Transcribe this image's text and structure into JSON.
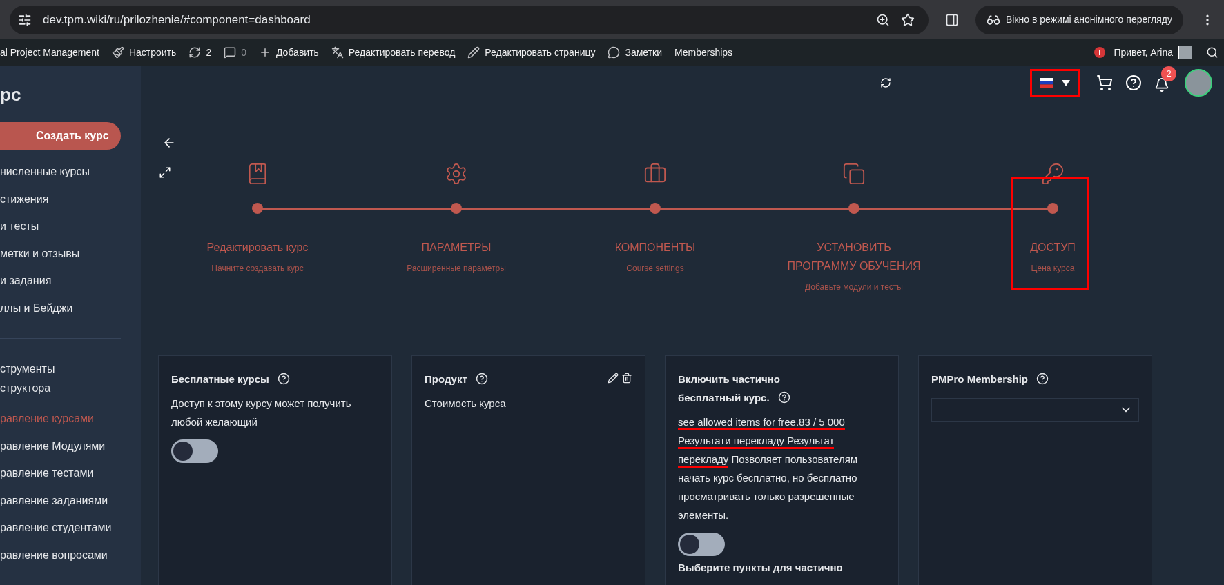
{
  "browser": {
    "url": "dev.tpm.wiki/ru/prilozhenie/#component=dashboard",
    "incognito_label": "Вікно в режимі анонімного перегляду"
  },
  "admin_bar": {
    "items": [
      {
        "kind": "brand",
        "label": "al Project Management"
      },
      {
        "kind": "customize",
        "label": "Настроить"
      },
      {
        "kind": "updates",
        "label": "2"
      },
      {
        "kind": "comments",
        "label": "0"
      },
      {
        "kind": "new",
        "label": "Добавить"
      },
      {
        "kind": "translate",
        "label": "Редактировать перевод"
      },
      {
        "kind": "edit",
        "label": "Редактировать страницу"
      },
      {
        "kind": "notes",
        "label": "Заметки"
      },
      {
        "kind": "plain",
        "label": "Memberships"
      }
    ],
    "greeting": "Привет, Arina"
  },
  "sidebar": {
    "title": "рс",
    "create_button": "Создать курс",
    "sections": [
      {
        "items": [
          {
            "label": "нисленные курсы",
            "selected": false
          },
          {
            "label": "стижения",
            "selected": false
          },
          {
            "label": "и тесты",
            "selected": false
          },
          {
            "label": "метки и отзывы",
            "selected": false
          },
          {
            "label": "и задания",
            "selected": false
          },
          {
            "label": "ллы и Бейджи",
            "selected": false
          }
        ]
      },
      {
        "heading": "струменты\nструктора",
        "items": [
          {
            "label": "равление курсами",
            "selected": true
          },
          {
            "label": "равление Модулями",
            "selected": false
          },
          {
            "label": "равление тестами",
            "selected": false
          },
          {
            "label": "равление заданиями",
            "selected": false
          },
          {
            "label": "равление студентами",
            "selected": false
          },
          {
            "label": "равление вопросами",
            "selected": false
          }
        ]
      }
    ]
  },
  "header": {
    "language": {
      "highlighted": true
    },
    "notifications": "2"
  },
  "steps": [
    {
      "kind": "edit",
      "title": "Редактировать курс",
      "subtitle": "Начните создавать курс",
      "highlighted": false
    },
    {
      "kind": "settings",
      "title": "ПАРАМЕТРЫ",
      "subtitle": "Расширенные параметры",
      "highlighted": false
    },
    {
      "kind": "components",
      "title": "КОМПОНЕНТЫ",
      "subtitle": "Course settings",
      "highlighted": false
    },
    {
      "kind": "program",
      "title": "УСТАНОВИТЬ ПРОГРАММУ ОБУЧЕНИЯ",
      "subtitle": "Добавьте модули и тесты",
      "highlighted": false
    },
    {
      "kind": "access",
      "title": "ДОСТУП",
      "subtitle": "Цена курса",
      "highlighted": true
    }
  ],
  "cards": [
    {
      "kind": "toggle",
      "title": "Бесплатные курсы",
      "help": true,
      "description": [
        {
          "text": "Доступ к этому курсу может получить любой желающий",
          "marked": false
        }
      ],
      "toggle": {
        "on": false
      }
    },
    {
      "kind": "product",
      "title": "Продукт",
      "help": true,
      "description": [
        {
          "text": "Стоимость курса",
          "marked": false
        }
      ]
    },
    {
      "kind": "toggle",
      "title": "Включить частично бесплатный курс.",
      "help": true,
      "description": [
        {
          "text": "see allowed items for free.83 / 5 000",
          "marked": true
        },
        {
          "text": "Результати перекладу Результат перекладу",
          "marked": true
        },
        {
          "text": "Позволяет пользователям начать курс бесплатно, но бесплатно просматривать только разрешенные элементы.",
          "marked": false
        }
      ],
      "toggle": {
        "on": false
      },
      "subheading": "Выберите пункты для частично"
    },
    {
      "kind": "select",
      "title": "PMPro Membership",
      "help": true
    }
  ]
}
